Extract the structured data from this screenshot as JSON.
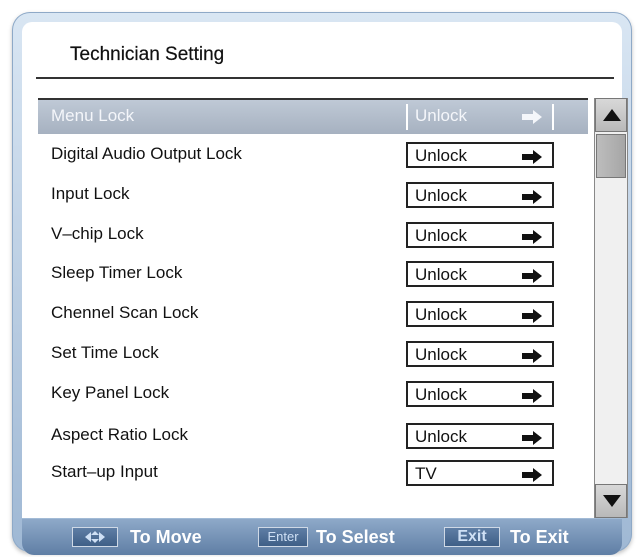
{
  "header": {
    "title": "Technician Setting"
  },
  "menu": {
    "items": [
      {
        "label": "Menu Lock",
        "value": "Unlock"
      },
      {
        "label": "Digital Audio Output Lock",
        "value": "Unlock"
      },
      {
        "label": "Input Lock",
        "value": "Unlock"
      },
      {
        "label": "V–chip Lock",
        "value": "Unlock"
      },
      {
        "label": "Sleep Timer Lock",
        "value": "Unlock"
      },
      {
        "label": "Chennel Scan Lock",
        "value": "Unlock"
      },
      {
        "label": "Set Time Lock",
        "value": "Unlock"
      },
      {
        "label": "Key Panel Lock",
        "value": "Unlock"
      },
      {
        "label": "Aspect Ratio Lock",
        "value": "Unlock"
      },
      {
        "label": "Start–up Input",
        "value": "TV"
      }
    ],
    "selected_index": 0
  },
  "footer": {
    "move_key": "move-arrows-icon",
    "move_text": "To Move",
    "enter_key": "Enter",
    "enter_text": "To Selest",
    "exit_key": "Exit",
    "exit_text": "To Exit"
  },
  "colors": {
    "frame": "#9fb8d4",
    "selected_row": "#a6b1c0",
    "footer": "#5f7ea5"
  },
  "icons": {
    "value_arrow": "right-arrow-icon",
    "scroll_up": "triangle-up-icon",
    "scroll_down": "triangle-down-icon"
  }
}
